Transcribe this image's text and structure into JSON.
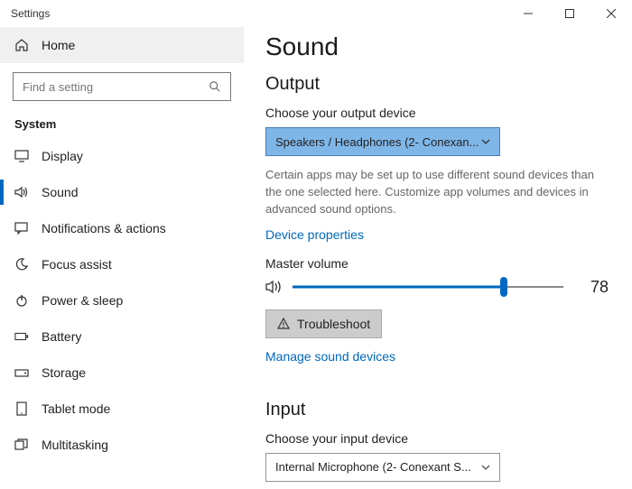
{
  "window": {
    "title": "Settings"
  },
  "sidebar": {
    "home": "Home",
    "search_placeholder": "Find a setting",
    "section": "System",
    "items": [
      {
        "label": "Display"
      },
      {
        "label": "Sound"
      },
      {
        "label": "Notifications & actions"
      },
      {
        "label": "Focus assist"
      },
      {
        "label": "Power & sleep"
      },
      {
        "label": "Battery"
      },
      {
        "label": "Storage"
      },
      {
        "label": "Tablet mode"
      },
      {
        "label": "Multitasking"
      }
    ]
  },
  "main": {
    "title": "Sound",
    "output": {
      "heading": "Output",
      "choose_label": "Choose your output device",
      "device": "Speakers / Headphones (2- Conexan...",
      "helper": "Certain apps may be set up to use different sound devices than the one selected here. Customize app volumes and devices in advanced sound options.",
      "device_props": "Device properties",
      "master_label": "Master volume",
      "volume": 78,
      "troubleshoot": "Troubleshoot",
      "manage": "Manage sound devices"
    },
    "input": {
      "heading": "Input",
      "choose_label": "Choose your input device",
      "device": "Internal Microphone (2- Conexant S..."
    }
  }
}
